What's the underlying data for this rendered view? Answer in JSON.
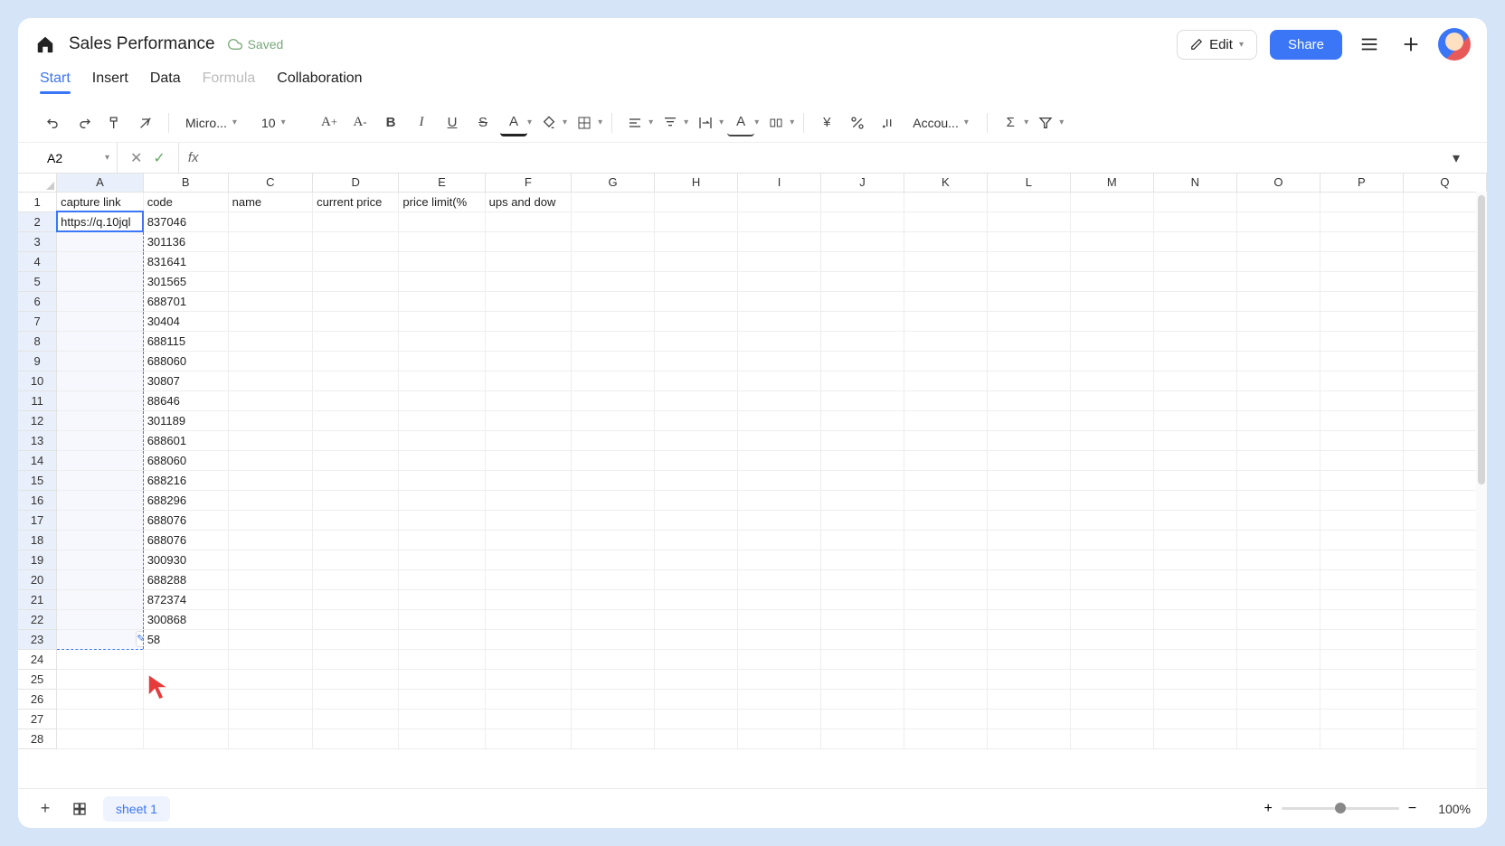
{
  "header": {
    "title": "Sales Performance",
    "saved_label": "Saved",
    "edit_label": "Edit",
    "share_label": "Share"
  },
  "tabs": [
    {
      "label": "Start",
      "active": true
    },
    {
      "label": "Insert"
    },
    {
      "label": "Data"
    },
    {
      "label": "Formula",
      "disabled": true
    },
    {
      "label": "Collaboration"
    }
  ],
  "toolbar": {
    "font_family": "Micro...",
    "font_size": "10",
    "number_format": "Accou..."
  },
  "formula_bar": {
    "cell_ref": "A2",
    "fx": "fx",
    "value": ""
  },
  "columns": [
    "A",
    "B",
    "C",
    "D",
    "E",
    "F",
    "G",
    "H",
    "I",
    "J",
    "K",
    "L",
    "M",
    "N",
    "O",
    "P",
    "Q"
  ],
  "col_widths": {
    "A": 96,
    "B": 96,
    "C": 96,
    "D": 96,
    "E": 96,
    "F": 96
  },
  "selected_column": "A",
  "selected_rows": [
    2,
    23
  ],
  "active_cell": "A2",
  "visible_row_count": 28,
  "headers_row": {
    "A": "capture link",
    "B": "code",
    "C": "name",
    "D": "current price",
    "E": "price limit(%",
    "F": "ups and dow"
  },
  "data_rows": [
    {
      "row": 2,
      "A": "https://q.10jql",
      "B": "837046"
    },
    {
      "row": 3,
      "A": "",
      "B": "301136"
    },
    {
      "row": 4,
      "A": "",
      "B": "831641"
    },
    {
      "row": 5,
      "A": "",
      "B": "301565"
    },
    {
      "row": 6,
      "A": "",
      "B": "688701"
    },
    {
      "row": 7,
      "A": "",
      "B": "30404"
    },
    {
      "row": 8,
      "A": "",
      "B": "688115"
    },
    {
      "row": 9,
      "A": "",
      "B": "688060"
    },
    {
      "row": 10,
      "A": "",
      "B": "30807"
    },
    {
      "row": 11,
      "A": "",
      "B": "88646"
    },
    {
      "row": 12,
      "A": "",
      "B": "301189"
    },
    {
      "row": 13,
      "A": "",
      "B": "688601"
    },
    {
      "row": 14,
      "A": "",
      "B": "688060"
    },
    {
      "row": 15,
      "A": "",
      "B": "688216"
    },
    {
      "row": 16,
      "A": "",
      "B": "688296"
    },
    {
      "row": 17,
      "A": "",
      "B": "688076"
    },
    {
      "row": 18,
      "A": "",
      "B": "688076"
    },
    {
      "row": 19,
      "A": "",
      "B": "300930"
    },
    {
      "row": 20,
      "A": "",
      "B": "688288"
    },
    {
      "row": 21,
      "A": "",
      "B": "872374"
    },
    {
      "row": 22,
      "A": "",
      "B": "300868"
    },
    {
      "row": 23,
      "A": "",
      "B": "    58"
    }
  ],
  "sheet_tab": "sheet 1",
  "zoom": "100%"
}
